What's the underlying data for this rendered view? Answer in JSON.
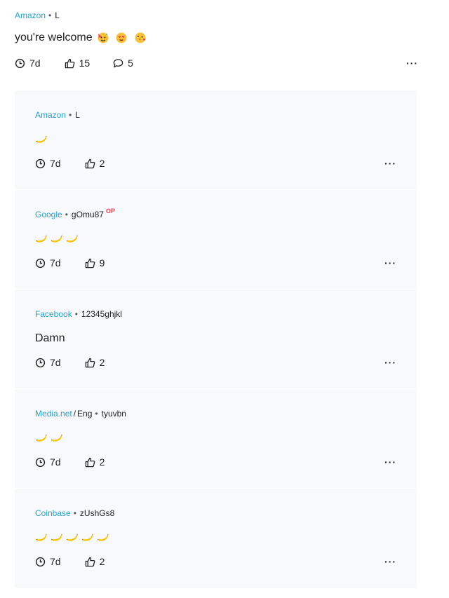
{
  "top_post": {
    "company": "Amazon",
    "username": "L",
    "text": "you're welcome",
    "time": "7d",
    "likes": "15",
    "comments": "5",
    "more_label": "···"
  },
  "replies": [
    {
      "company": "Amazon",
      "sub_company": "",
      "username": "L",
      "badge": "",
      "text": "",
      "bananas": 1,
      "time": "7d",
      "likes": "2"
    },
    {
      "company": "Google",
      "sub_company": "",
      "username": "gOmu87",
      "badge": "OP",
      "text": "",
      "bananas": 3,
      "time": "7d",
      "likes": "9"
    },
    {
      "company": "Facebook",
      "sub_company": "",
      "username": "12345ghjkl",
      "badge": "",
      "text": "Damn",
      "bananas": 0,
      "time": "7d",
      "likes": "2"
    },
    {
      "company": "Media.net",
      "sub_company": "Eng",
      "username": "tyuvbn",
      "badge": "",
      "text": "",
      "bananas": 2,
      "time": "7d",
      "likes": "2"
    },
    {
      "company": "Coinbase",
      "sub_company": "",
      "username": "zUshGs8",
      "badge": "",
      "text": "",
      "bananas": 5,
      "time": "7d",
      "likes": "2"
    }
  ],
  "icons": {
    "clock": "clock-icon",
    "like": "thumbs-up-icon",
    "comment": "comment-icon",
    "more": "more-dots-icon",
    "banana": "banana-emoji"
  },
  "colors": {
    "company_link": "#2aa0c4",
    "op_badge": "#e0405a",
    "reply_background": "#f8f9fb"
  }
}
